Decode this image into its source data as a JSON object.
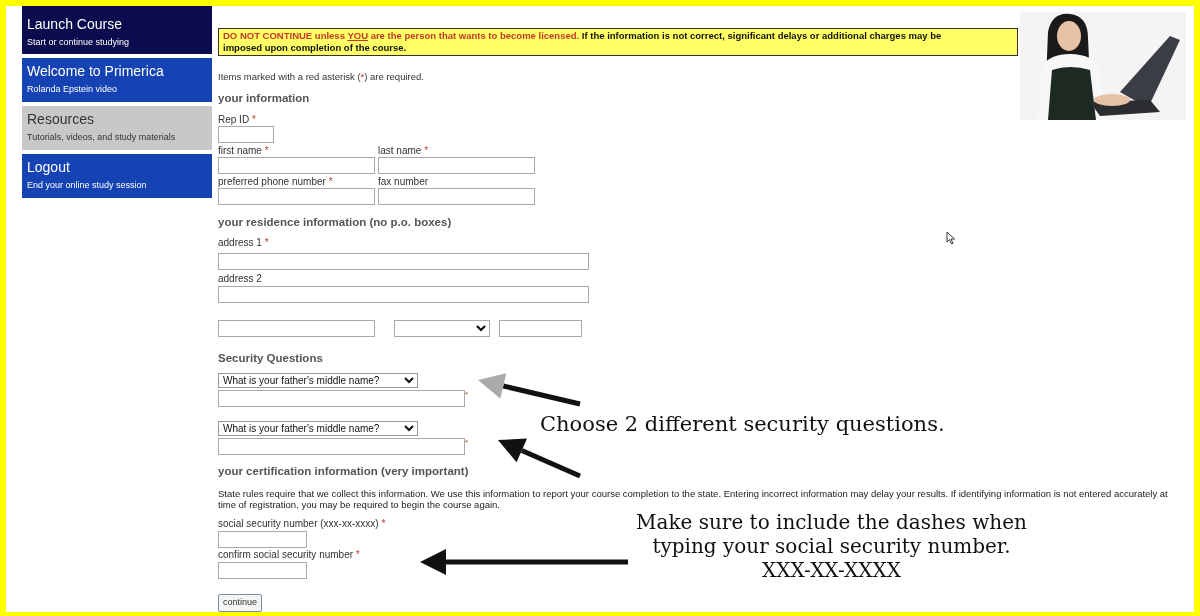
{
  "sidebar": {
    "items": [
      {
        "title": "Launch Course",
        "subtitle": "Start or continue studying",
        "color": "#0b0b4d"
      },
      {
        "title": "Welcome to Primerica",
        "subtitle": "Rolanda Epstein video",
        "color": "#1543b3"
      },
      {
        "title": "Resources",
        "subtitle": "Tutorials, videos, and study materials",
        "color": "#c8c8c8"
      },
      {
        "title": "Logout",
        "subtitle": "End your online study session",
        "color": "#1543b3"
      }
    ]
  },
  "notice": {
    "warning_lead": "DO NOT CONTINUE unless ",
    "warning_emphasis": "YOU",
    "warning_tail": " are the person that wants to become licensed.",
    "detail": " If the information is not correct, significant delays or additional charges may be imposed upon completion of the course."
  },
  "required_note": {
    "before": "Items marked with a red asterisk (",
    "mark": "*",
    "after": ") are required."
  },
  "your_information": {
    "heading": "your information",
    "rep_id": {
      "label": "Rep ID",
      "mark": "*"
    },
    "rows": [
      [
        {
          "label": "first name",
          "mark": "*"
        },
        {
          "label": "last name",
          "mark": "*"
        }
      ],
      [
        {
          "label": "preferred phone number",
          "mark": "*"
        },
        {
          "label": "fax number"
        }
      ]
    ]
  },
  "residence": {
    "heading": "your residence information (no p.o. boxes)",
    "address_1": {
      "label": "address 1",
      "mark": "*"
    },
    "address_2": {
      "label": "address 2"
    }
  },
  "security": {
    "heading": "Security Questions",
    "questions": [
      {
        "question": "What is your father's middle name?",
        "mark": "*"
      },
      {
        "question": "What is your father's middle name?",
        "mark": "*"
      }
    ]
  },
  "certification": {
    "heading": "your certification information (very important)",
    "note": "State rules require that we collect this information. We use this information to report your course completion to the state. Entering incorrect information may delay your results. If identifying information is not entered accurately at time of registration, you may be required to begin the course again.",
    "fields": [
      {
        "label": "social security number (xxx-xx-xxxx)",
        "mark": "*"
      },
      {
        "label": "confirm social security number",
        "mark": "*"
      }
    ],
    "button": "continue"
  },
  "annotations": {
    "security_hint": "Choose 2 different security questions.",
    "ssn_hint": [
      "Make sure to include the dashes when",
      "typing your social security number.",
      "XXX-XX-XXXX"
    ]
  }
}
